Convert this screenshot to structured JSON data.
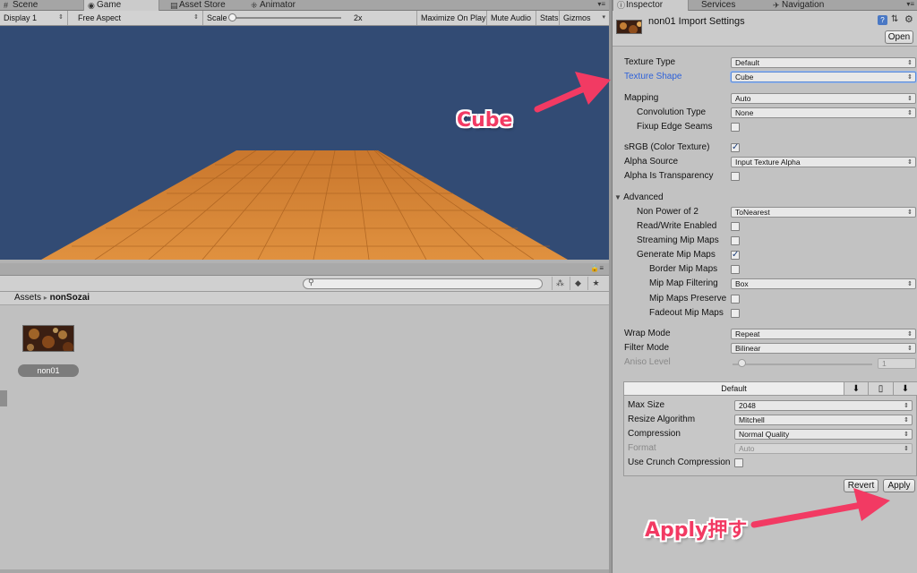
{
  "tabs_left": {
    "scene": "Scene",
    "game": "Game",
    "asset_store": "Asset Store",
    "animator": "Animator"
  },
  "tabs_right": {
    "inspector": "Inspector",
    "services": "Services",
    "navigation": "Navigation"
  },
  "game_toolbar": {
    "display": "Display 1",
    "aspect": "Free Aspect",
    "scale_label": "Scale",
    "scale_value": "2x",
    "maximize": "Maximize On Play",
    "mute": "Mute Audio",
    "stats": "Stats",
    "gizmos": "Gizmos"
  },
  "project": {
    "breadcrumb_root": "Assets",
    "breadcrumb_sep": "▸",
    "breadcrumb_folder": "nonSozai",
    "asset_name": "non01"
  },
  "inspector": {
    "title": "non01 Import Settings",
    "open_button": "Open",
    "fields": {
      "texture_type": {
        "label": "Texture Type",
        "value": "Default"
      },
      "texture_shape": {
        "label": "Texture Shape",
        "value": "Cube"
      },
      "mapping": {
        "label": "Mapping",
        "value": "Auto"
      },
      "convolution_type": {
        "label": "Convolution Type",
        "value": "None"
      },
      "fixup_edge_seams": {
        "label": "Fixup Edge Seams"
      },
      "srgb": {
        "label": "sRGB (Color Texture)"
      },
      "alpha_source": {
        "label": "Alpha Source",
        "value": "Input Texture Alpha"
      },
      "alpha_is_transparency": {
        "label": "Alpha Is Transparency"
      },
      "advanced": {
        "label": "Advanced"
      },
      "non_power_of_2": {
        "label": "Non Power of 2",
        "value": "ToNearest"
      },
      "read_write": {
        "label": "Read/Write Enabled"
      },
      "streaming_mip": {
        "label": "Streaming Mip Maps"
      },
      "generate_mip": {
        "label": "Generate Mip Maps"
      },
      "border_mip": {
        "label": "Border Mip Maps"
      },
      "mip_filtering": {
        "label": "Mip Map Filtering",
        "value": "Box"
      },
      "mip_preserve": {
        "label": "Mip Maps Preserve"
      },
      "fadeout_mip": {
        "label": "Fadeout Mip Maps"
      },
      "wrap_mode": {
        "label": "Wrap Mode",
        "value": "Repeat"
      },
      "filter_mode": {
        "label": "Filter Mode",
        "value": "Bilinear"
      },
      "aniso_level": {
        "label": "Aniso Level",
        "value": "1"
      }
    },
    "platform": {
      "tab_default": "Default",
      "max_size": {
        "label": "Max Size",
        "value": "2048"
      },
      "resize_algorithm": {
        "label": "Resize Algorithm",
        "value": "Mitchell"
      },
      "compression": {
        "label": "Compression",
        "value": "Normal Quality"
      },
      "format": {
        "label": "Format",
        "value": "Auto"
      },
      "crunch": {
        "label": "Use Crunch Compression"
      }
    },
    "revert_button": "Revert",
    "apply_button": "Apply"
  },
  "annotations": {
    "cube": "Cube",
    "apply": "Apply押す"
  },
  "colors": {
    "accent_label": "#2f62d9",
    "annotation": "#f23a63",
    "game_bg": "#324b74",
    "floor": "#d98a3a"
  }
}
